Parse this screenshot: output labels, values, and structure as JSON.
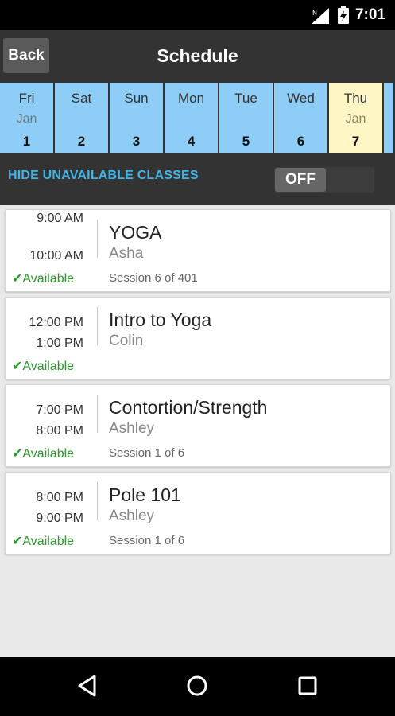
{
  "status_bar": {
    "time": "7:01"
  },
  "header": {
    "back_label": "Back",
    "title": "Schedule"
  },
  "days": [
    {
      "name": "Fri",
      "month": "Jan",
      "num": "1",
      "selected": false
    },
    {
      "name": "Sat",
      "month": "",
      "num": "2",
      "selected": false
    },
    {
      "name": "Sun",
      "month": "",
      "num": "3",
      "selected": false
    },
    {
      "name": "Mon",
      "month": "",
      "num": "4",
      "selected": false
    },
    {
      "name": "Tue",
      "month": "",
      "num": "5",
      "selected": false
    },
    {
      "name": "Wed",
      "month": "",
      "num": "6",
      "selected": false
    },
    {
      "name": "Thu",
      "month": "Jan",
      "num": "7",
      "selected": true
    }
  ],
  "filter": {
    "label": "HIDE UNAVAILABLE CLASSES",
    "toggle_state": "OFF"
  },
  "classes": [
    {
      "start": "9:00 AM",
      "end": "10:00 AM",
      "availability": "✔Available",
      "name": "YOGA",
      "instructor": "Asha",
      "session": "Session 6 of 401"
    },
    {
      "start": "12:00 PM",
      "end": "1:00 PM",
      "availability": "✔Available",
      "name": "Intro to Yoga",
      "instructor": "Colin",
      "session": ""
    },
    {
      "start": "7:00 PM",
      "end": "8:00 PM",
      "availability": "✔Available",
      "name": "Contortion/Strength",
      "instructor": "Ashley",
      "session": "Session 1 of 6"
    },
    {
      "start": "8:00 PM",
      "end": "9:00 PM",
      "availability": "✔Available",
      "name": "Pole 101",
      "instructor": "Ashley",
      "session": "Session 1 of 6"
    }
  ],
  "colors": {
    "day_bg": "#8dcdf6",
    "day_selected_bg": "#fff6c5",
    "accent": "#3fb5e8",
    "available": "#2a9a2a",
    "header_bg": "#333333"
  },
  "icons": {
    "signal": "signal-icon",
    "battery": "battery-charging-icon",
    "nav_back": "back-triangle-icon",
    "nav_home": "home-circle-icon",
    "nav_recents": "recents-square-icon"
  }
}
